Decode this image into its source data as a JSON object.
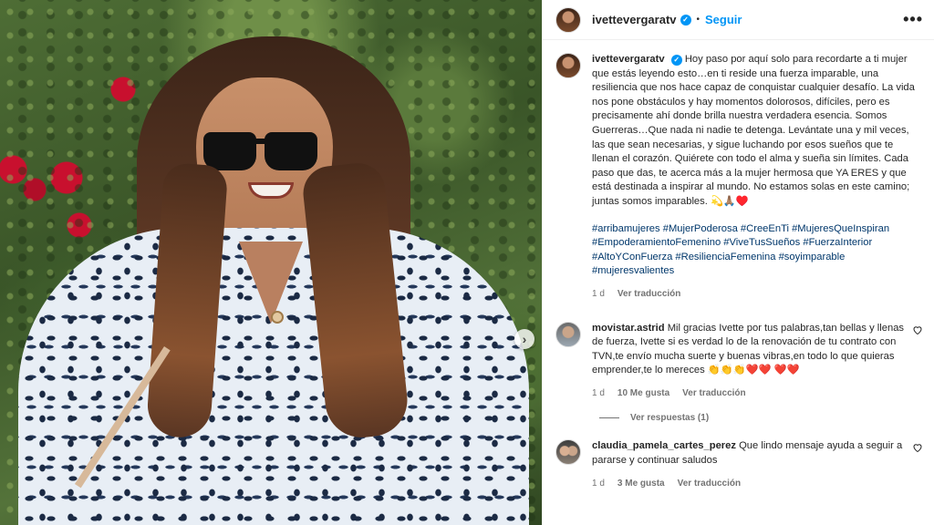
{
  "post": {
    "username": "ivettevergaratv",
    "follow_label": "Seguir",
    "dot": "•",
    "more_label": "•••",
    "next_label": "›",
    "caption_text": "Hoy paso por aquí solo para recordarte a ti mujer que estás leyendo esto…en ti reside una fuerza imparable, una resiliencia que nos hace capaz de conquistar cualquier desafío. La vida nos pone obstáculos y hay momentos dolorosos, difíciles, pero es precisamente ahí donde brilla nuestra verdadera esencia. Somos Guerreras…Que nada ni nadie te detenga. Levántate una y mil veces, las que sean necesarias, y sigue luchando por esos sueños que te llenan el corazón. Quiérete con todo el alma y sueña sin límites. Cada paso que das, te acerca más a la mujer hermosa que YA ERES y que está destinada a inspirar al mundo. No estamos solas en este camino; juntas somos imparables. 💫🙏🏽♥️",
    "hashtags": "#arribamujeres #MujerPoderosa #CreeEnTi #MujeresQueInspiran #EmpoderamientoFemenino #ViveTusSueños #FuerzaInterior #AltoYConFuerza #ResilienciaFemenina #soyimparable #mujeresvalientes",
    "time": "1 d",
    "translate_label": "Ver traducción"
  },
  "comments": [
    {
      "username": "movistar.astrid",
      "text": "Mil gracias Ivette por tus palabras,tan bellas y llenas de fuerza, Ivette si es verdad lo de la renovación de tu contrato con TVN,te envío mucha suerte y buenas vibras,en todo lo que quieras emprender,te lo mereces 👏👏👏❤️❤️ ❤️❤️",
      "time": "1 d",
      "likes": "10 Me gusta",
      "translate_label": "Ver traducción",
      "replies_label": "Ver respuestas (1)"
    },
    {
      "username": "claudia_pamela_cartes_perez",
      "text": "Que lindo mensaje ayuda a seguir a pararse y continuar saludos",
      "time": "1 d",
      "likes": "3 Me gusta",
      "translate_label": "Ver traducción"
    }
  ],
  "colors": {
    "accent": "#0095f6",
    "hashtag": "#00376b",
    "muted": "#737373"
  }
}
